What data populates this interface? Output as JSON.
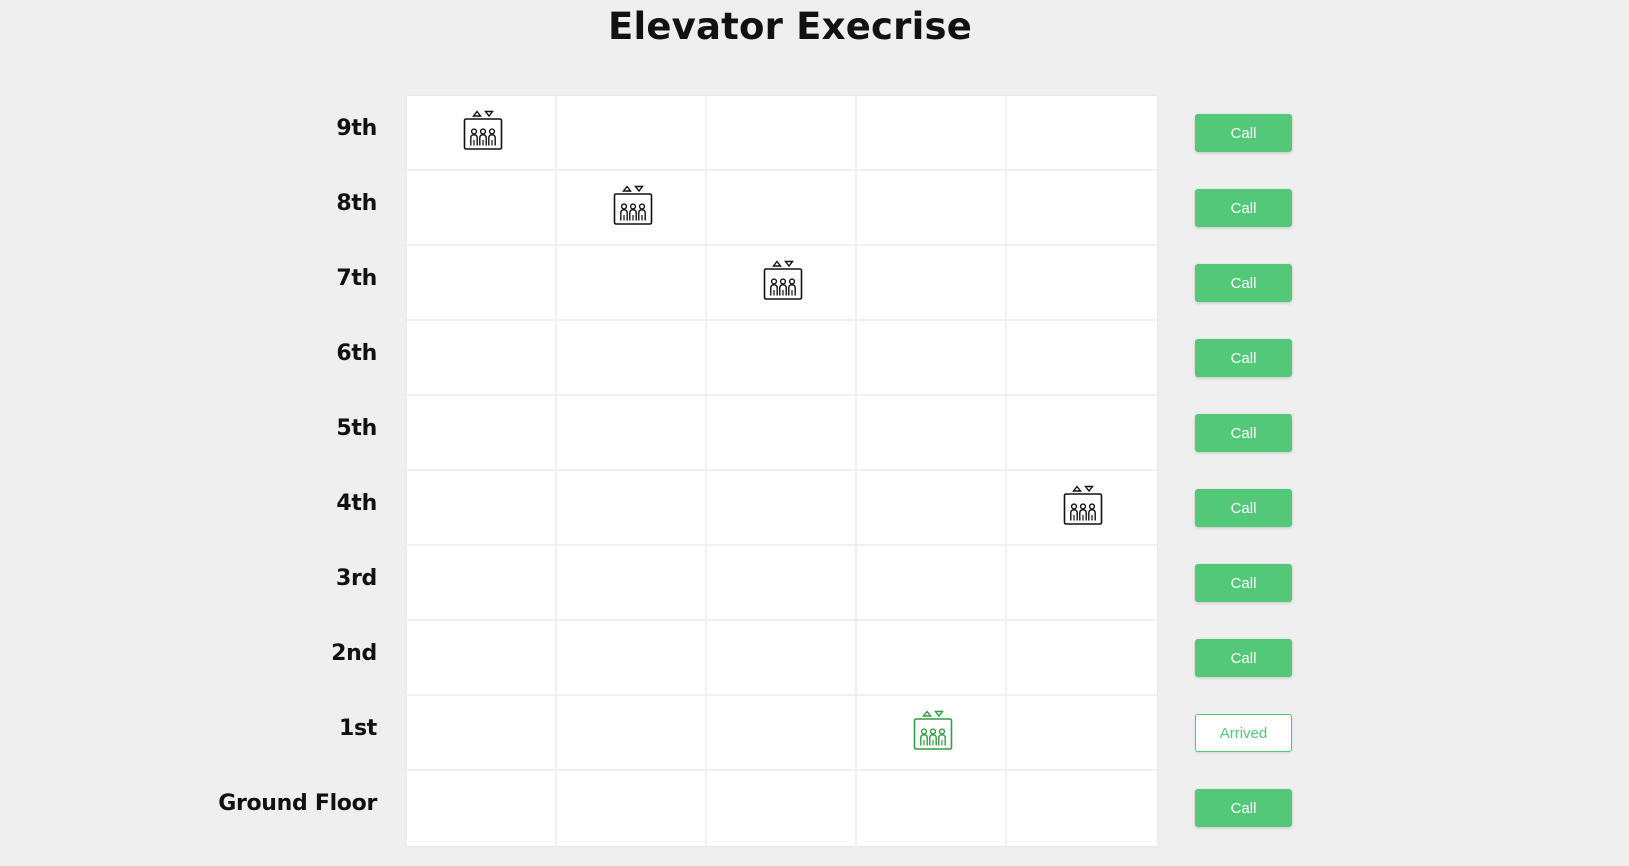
{
  "title": "Elevator Execrise",
  "floors": [
    {
      "label": "9th",
      "button": "Call",
      "state": "idle"
    },
    {
      "label": "8th",
      "button": "Call",
      "state": "idle"
    },
    {
      "label": "7th",
      "button": "Call",
      "state": "idle"
    },
    {
      "label": "6th",
      "button": "Call",
      "state": "idle"
    },
    {
      "label": "5th",
      "button": "Call",
      "state": "idle"
    },
    {
      "label": "4th",
      "button": "Call",
      "state": "idle"
    },
    {
      "label": "3rd",
      "button": "Call",
      "state": "idle"
    },
    {
      "label": "2nd",
      "button": "Call",
      "state": "idle"
    },
    {
      "label": "1st",
      "button": "Arrived",
      "state": "arrived"
    },
    {
      "label": "Ground Floor",
      "button": "Call",
      "state": "idle"
    }
  ],
  "shafts": 5,
  "elevators": [
    {
      "shaft": 1,
      "floor": "9th",
      "status": "idle"
    },
    {
      "shaft": 2,
      "floor": "8th",
      "status": "idle"
    },
    {
      "shaft": 3,
      "floor": "7th",
      "status": "idle"
    },
    {
      "shaft": 4,
      "floor": "1st",
      "status": "arrived"
    },
    {
      "shaft": 5,
      "floor": "4th",
      "status": "idle"
    }
  ],
  "icon": "elevator-icon",
  "colors": {
    "background": "#efefef",
    "grid": "#ffffff",
    "button": "#52c878",
    "button_text": "#ffffff",
    "elevator_idle": "#111111",
    "elevator_arrived": "#2e9e3e"
  }
}
